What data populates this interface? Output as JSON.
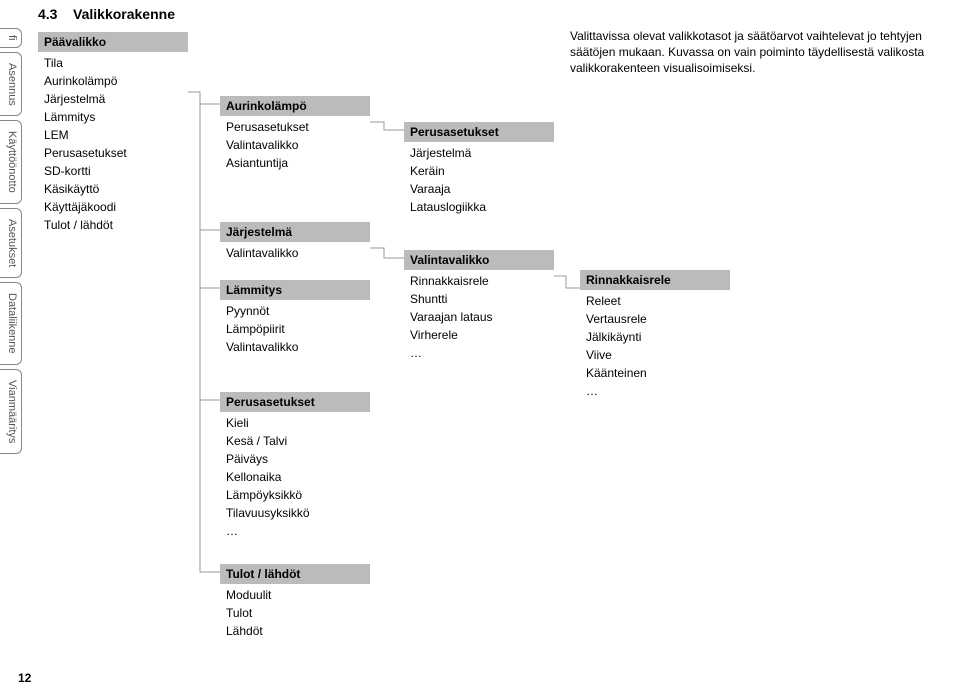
{
  "page": {
    "section_number": "4.3",
    "section_title": "Valikkorakenne",
    "description": "Valittavissa olevat valikkotasot ja säätöarvot vaihtelevat jo tehtyjen säätöjen mukaan. Kuvassa on vain poiminto täydellisestä valikosta valikkorakenteen visualisoimiseksi.",
    "page_number": "12"
  },
  "tabs": {
    "t0": "fi",
    "t1": "Asennus",
    "t2": "Käyttöönotto",
    "t3": "Asetukset",
    "t4": "Dataliikenne",
    "t5": "Vianmääritys"
  },
  "col1": {
    "header": "Päävalikko",
    "items": [
      "Tila",
      "Aurinkolämpö",
      "Järjestelmä",
      "Lämmitys",
      "LEM",
      "Perusasetukset",
      "SD-kortti",
      "Käsikäyttö",
      "Käyttäjäkoodi",
      "Tulot / lähdöt"
    ]
  },
  "col2a": {
    "header": "Aurinkolämpö",
    "items": [
      "Perusasetukset",
      "Valintavalikko",
      "Asiantuntija"
    ]
  },
  "col2b": {
    "header": "Järjestelmä",
    "items": [
      "Valintavalikko"
    ]
  },
  "col2c": {
    "header": "Lämmitys",
    "items": [
      "Pyynnöt",
      "Lämpöpiirit",
      "Valintavalikko"
    ]
  },
  "col2d": {
    "header": "Perusasetukset",
    "items": [
      "Kieli",
      "Kesä / Talvi",
      "Päiväys",
      "Kellonaika",
      "Lämpöyksikkö",
      "Tilavuusyksikkö",
      "…"
    ]
  },
  "col2e": {
    "header": "Tulot / lähdöt",
    "items": [
      "Moduulit",
      "Tulot",
      "Lähdöt"
    ]
  },
  "col3a": {
    "header": "Perusasetukset",
    "items": [
      "Järjestelmä",
      "Keräin",
      "Varaaja",
      "Latauslogiikka"
    ]
  },
  "col3b": {
    "header": "Valintavalikko",
    "items": [
      "Rinnakkaisrele",
      "Shuntti",
      "Varaajan lataus",
      "Virherele",
      "…"
    ]
  },
  "col4a": {
    "header": "Rinnakkaisrele",
    "items": [
      "Releet",
      "Vertausrele",
      "Jälkikäynti",
      "Viive",
      "Käänteinen",
      "…"
    ]
  }
}
